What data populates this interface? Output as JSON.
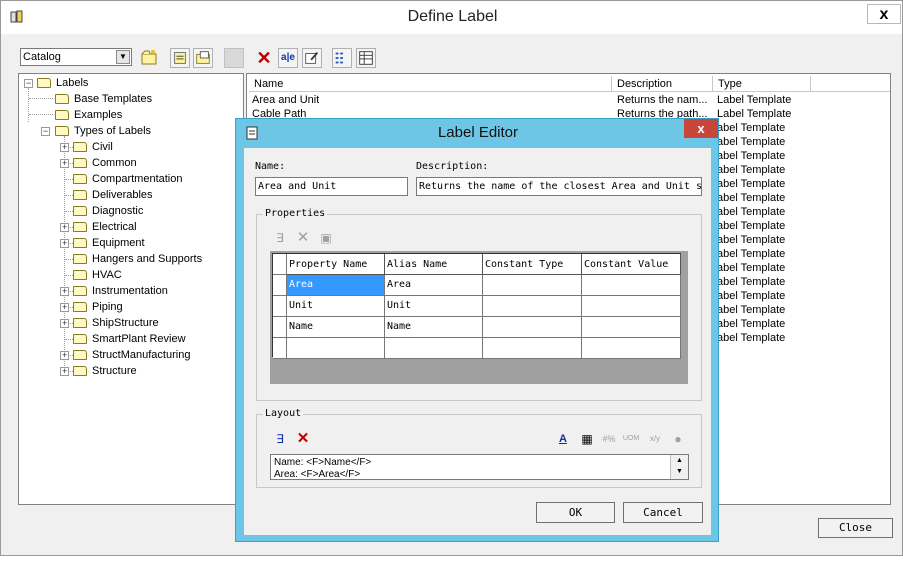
{
  "window": {
    "title": "Define Label",
    "close_label": "x"
  },
  "toolbar": {
    "catalog_value": "Catalog",
    "icons": [
      "new-folder-icon",
      "properties-icon",
      "open-folder-icon",
      "disabled-icon",
      "delete-icon",
      "rename-icon",
      "edit-properties-icon",
      "list-view-icon",
      "details-view-icon"
    ]
  },
  "tree": {
    "root": "Labels",
    "items": [
      "Base Templates",
      "Examples",
      "Types of Labels",
      "Civil",
      "Common",
      "Compartmentation",
      "Deliverables",
      "Diagnostic",
      "Electrical",
      "Equipment",
      "Hangers and Supports",
      "HVAC",
      "Instrumentation",
      "Piping",
      "ShipStructure",
      "SmartPlant Review",
      "StructManufacturing",
      "Structure"
    ]
  },
  "list": {
    "columns": [
      "Name",
      "Description",
      "Type"
    ],
    "rows": [
      {
        "name": "Area and Unit",
        "description": "Returns the nam...",
        "type": "Label Template"
      },
      {
        "name": "Cable Path",
        "description": "Returns the path...",
        "type": "Label Template"
      },
      {
        "type": "abel Template"
      },
      {
        "type": "abel Template"
      },
      {
        "type": "abel Template"
      },
      {
        "type": "abel Template"
      },
      {
        "type": "abel Template"
      },
      {
        "type": "abel Template"
      },
      {
        "type": "abel Template"
      },
      {
        "type": "abel Template"
      },
      {
        "type": "abel Template"
      },
      {
        "type": "abel Template"
      },
      {
        "type": "abel Template"
      },
      {
        "type": "abel Template"
      },
      {
        "type": "abel Template"
      },
      {
        "type": "abel Template"
      },
      {
        "type": "abel Template"
      },
      {
        "type": "abel Template"
      }
    ]
  },
  "close_button": "Close",
  "dialog": {
    "title": "Label Editor",
    "close_label": "x",
    "name_label": "Name:",
    "name_value": "Area and Unit",
    "description_label": "Description:",
    "description_value": "Returns the name of the closest Area and Unit s",
    "properties_title": "Properties",
    "grid": {
      "columns": [
        "Property Name",
        "Alias Name",
        "Constant Type",
        "Constant Value"
      ],
      "rows": [
        [
          "Area",
          "Area",
          "",
          ""
        ],
        [
          "Unit",
          "Unit",
          "",
          ""
        ],
        [
          "Name",
          "Name",
          "",
          ""
        ],
        [
          "",
          "",
          "",
          ""
        ]
      ]
    },
    "layout_title": "Layout",
    "layout_lines": [
      "Name: <F>Name</F>",
      "Area: <F>Area</F>"
    ],
    "ok_label": "OK",
    "cancel_label": "Cancel"
  }
}
